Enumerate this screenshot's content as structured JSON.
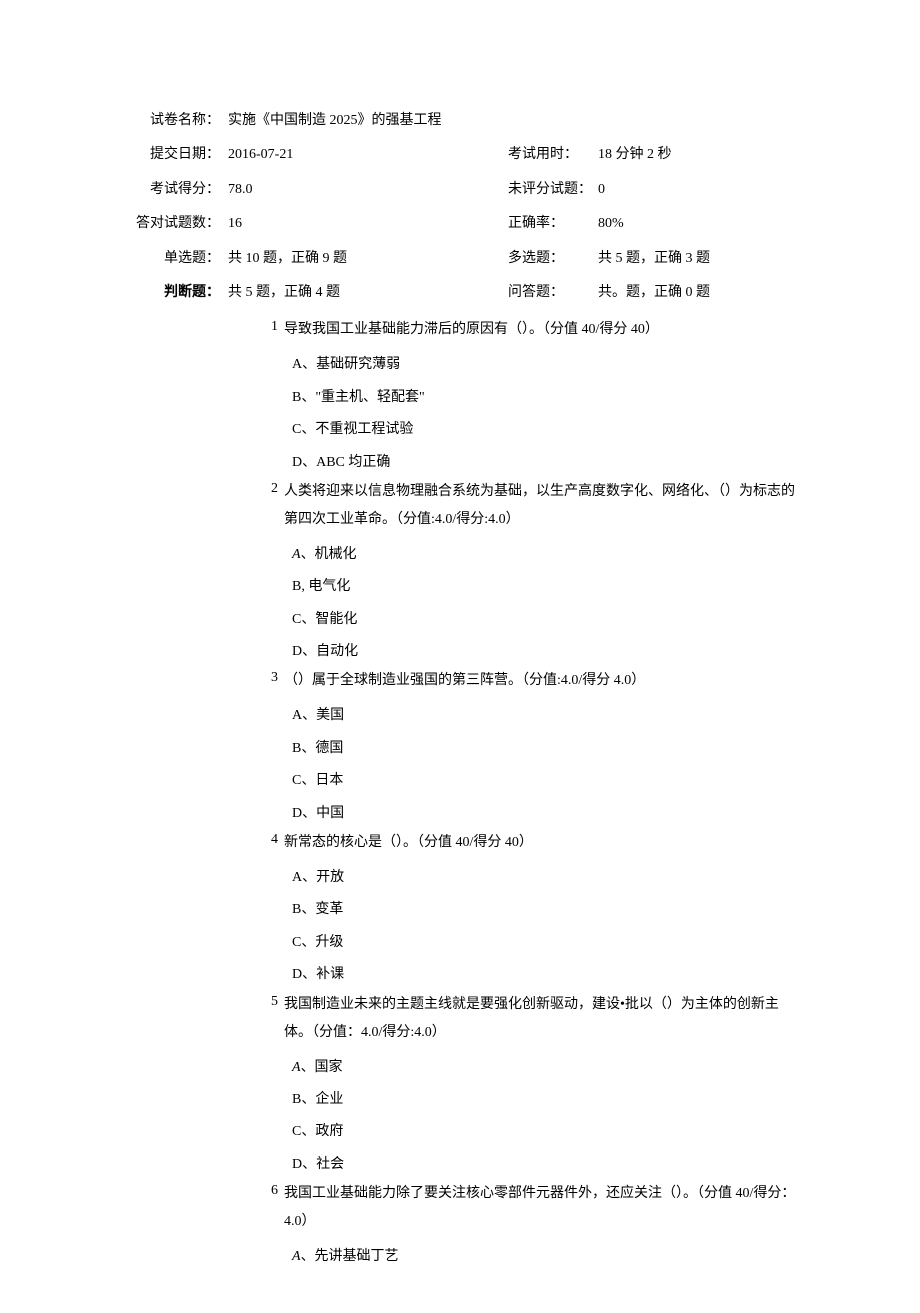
{
  "meta": {
    "row1": {
      "label": "试卷名称：",
      "value": "实施《中国制造 2025》的强基工程"
    },
    "row2": {
      "label": "提交日期：",
      "value": "2016-07-21",
      "label2": "考试用时：",
      "value2": "18 分钟 2 秒"
    },
    "row3": {
      "label": "考试得分：",
      "value": "78.0",
      "label2": "未评分试题：",
      "value2": "0"
    },
    "row4": {
      "label": "答对试题数：",
      "value": "16",
      "label2": "正确率：",
      "value2": "80%"
    },
    "row5": {
      "label": "单选题：",
      "value": "共 10 题，正确 9 题",
      "label2": "多选题：",
      "value2": "共 5 题，正确 3 题"
    },
    "row6": {
      "label": "判断题：",
      "value": "共 5 题，正确 4 题",
      "label2": "问答题：",
      "value2": "共。题，正确 0 题"
    }
  },
  "q": [
    {
      "num": "1",
      "text": "导致我国工业基础能力滞后的原因有（）。（分值 40/得分 40）",
      "opts": [
        "A、基础研究薄弱",
        "B、\"重主机、轻配套\"",
        "C、不重视工程试验",
        "D、ABC 均正确"
      ]
    },
    {
      "num": "2",
      "text": "人类将迎来以信息物理融合系统为基础，以生产高度数字化、网络化、（）为标志的第四次工业革命。（分值:4.0/得分:4.0）",
      "opts": [
        "、机械化",
        "B, 电气化",
        "C、智能化",
        "D、自动化"
      ],
      "italicA": true
    },
    {
      "num": "3",
      "text": "（）属于全球制造业强国的第三阵营。（分值:4.0/得分 4.0）",
      "opts": [
        "A、美国",
        "B、德国",
        "C、日本",
        "D、中国"
      ]
    },
    {
      "num": "4",
      "text": "新常态的核心是（）。（分值 40/得分 40）",
      "opts": [
        "A、开放",
        "B、变革",
        "C、升级",
        "D、补课"
      ]
    },
    {
      "num": "5",
      "text": "我国制造业未来的主题主线就是要强化创新驱动，建设•批以（）为主体的创新主体。（分值：4.0/得分:4.0）",
      "opts": [
        "、国家",
        "B、企业",
        "C、政府",
        "D、社会"
      ],
      "italicA": true
    },
    {
      "num": "6",
      "text": "我国工业基础能力除了要关注核心零部件元器件外，还应关注（）。（分值 40/得分：4.0）",
      "opts": [
        "、先讲基础丁艺"
      ],
      "italicA": true
    }
  ]
}
